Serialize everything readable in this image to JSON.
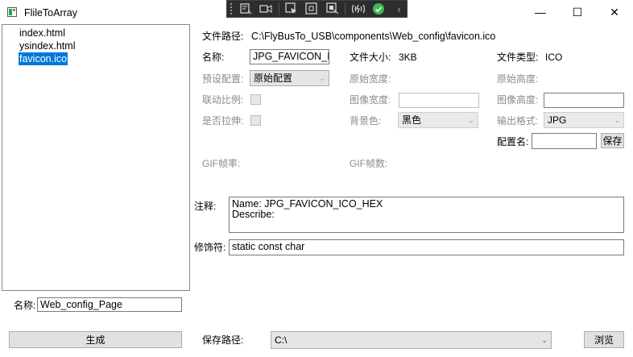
{
  "window": {
    "title": "FlileToArray",
    "minimize": "—",
    "maximize": "☐",
    "close": "✕"
  },
  "file_list": [
    "index.html",
    "ysindex.html",
    "favicon.ico"
  ],
  "file_list_selected": 2,
  "file_path": {
    "label": "文件路径:",
    "value": "C:\\FlyBusTo_USB\\components\\Web_config\\favicon.ico"
  },
  "name": {
    "label": "名称:",
    "value": "JPG_FAVICON_ICO"
  },
  "file_size": {
    "label": "文件大小:",
    "value": "3KB"
  },
  "file_type": {
    "label": "文件类型:",
    "value": "ICO"
  },
  "preset": {
    "label": "预设配置:",
    "value": "原始配置"
  },
  "original_width": {
    "label": "原始宽度:"
  },
  "original_height": {
    "label": "原始高度:"
  },
  "link_ratio": {
    "label": "联动比例:"
  },
  "image_width": {
    "label": "图像宽度:",
    "value": ""
  },
  "image_height": {
    "label": "图像高度:",
    "value": ""
  },
  "stretch": {
    "label": "是否拉伸:"
  },
  "background": {
    "label": "背景色:",
    "value": "黑色"
  },
  "output_format": {
    "label": "输出格式:",
    "value": "JPG"
  },
  "config_name": {
    "label": "配置名:",
    "value": ""
  },
  "save_button": "保存",
  "gif_frame_rate": {
    "label": "GIF帧率:"
  },
  "gif_frame_count": {
    "label": "GIF帧数:"
  },
  "comment": {
    "label": "注释:",
    "value": "Name: JPG_FAVICON_ICO_HEX\nDescribe:"
  },
  "modifier": {
    "label": "修饰符:",
    "value": "static const char"
  },
  "page_name": {
    "label": "名称:",
    "value": "Web_config_Page"
  },
  "generate_button": "生成",
  "save_path": {
    "label": "保存路径:",
    "value": "C:\\"
  },
  "browse_button": "浏览",
  "colors": {
    "selection": "#0078d7",
    "dbg_bar": "#2d2d30",
    "check_green": "#3fb950"
  }
}
